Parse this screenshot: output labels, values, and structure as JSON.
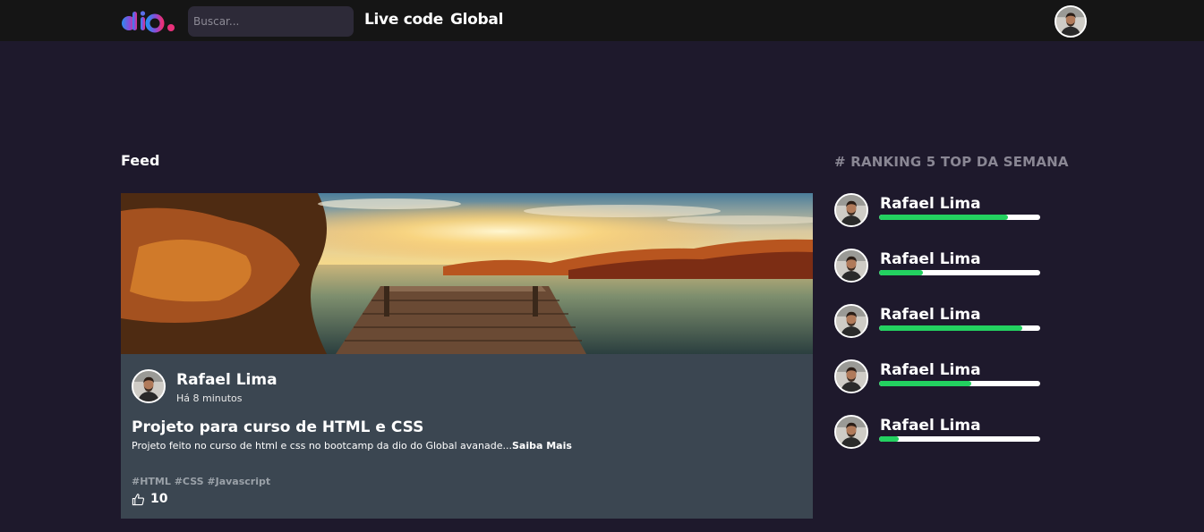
{
  "header": {
    "search_placeholder": "Buscar...",
    "nav": [
      "Live code",
      "Global"
    ]
  },
  "feed": {
    "title": "Feed",
    "post": {
      "author": "Rafael Lima",
      "time": "Há 8 minutos",
      "title": "Projeto para curso de HTML e CSS",
      "description": "Projeto feito no curso de html e css no bootcamp da dio do Global avanade...",
      "read_more": "Saiba Mais",
      "tags": "#HTML #CSS #Javascript",
      "likes": "10"
    }
  },
  "ranking": {
    "title": "# RANKING 5 TOP DA SEMANA",
    "items": [
      {
        "name": "Rafael Lima",
        "progress": 0.8
      },
      {
        "name": "Rafael Lima",
        "progress": 0.27
      },
      {
        "name": "Rafael Lima",
        "progress": 0.89
      },
      {
        "name": "Rafael Lima",
        "progress": 0.57
      },
      {
        "name": "Rafael Lima",
        "progress": 0.12
      }
    ]
  },
  "colors": {
    "background": "#1e192c",
    "topbar": "#151515",
    "card": "#3b4651",
    "progress_fill": "#23d160",
    "ranking_title": "#8a8794"
  }
}
